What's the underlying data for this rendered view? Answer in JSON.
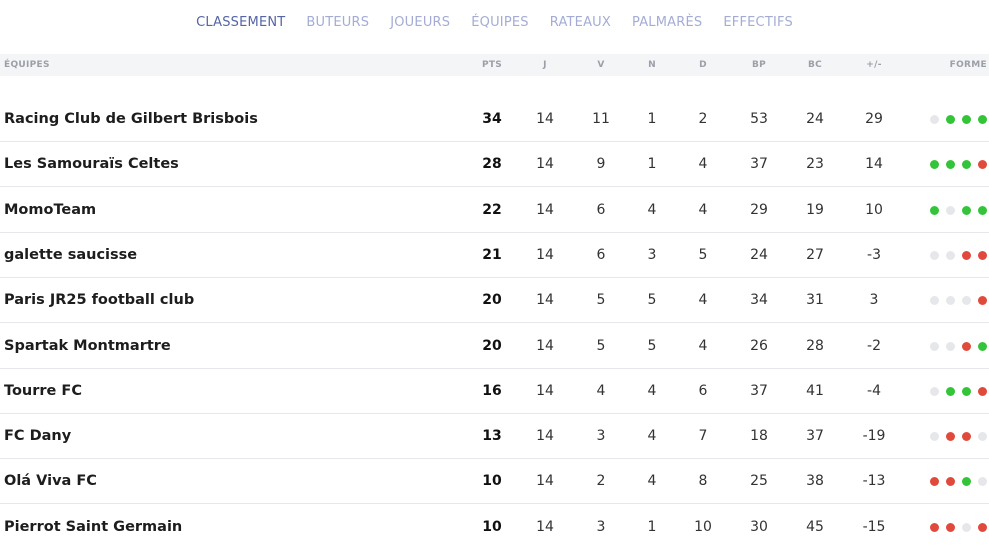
{
  "nav": [
    {
      "label": "CLASSEMENT",
      "active": true
    },
    {
      "label": "BUTEURS",
      "active": false
    },
    {
      "label": "JOUEURS",
      "active": false
    },
    {
      "label": "ÉQUIPES",
      "active": false
    },
    {
      "label": "RATEAUX",
      "active": false
    },
    {
      "label": "PALMARÈS",
      "active": false
    },
    {
      "label": "EFFECTIFS",
      "active": false
    }
  ],
  "columns": {
    "team": "ÉQUIPES",
    "pts": "PTS",
    "j": "J",
    "v": "V",
    "n": "N",
    "d": "D",
    "bp": "BP",
    "bc": "BC",
    "diff": "+/-",
    "form": "FORME"
  },
  "rows": [
    {
      "team": "Racing Club de Gilbert Brisbois",
      "pts": "34",
      "j": "14",
      "v": "11",
      "n": "1",
      "d": "2",
      "bp": "53",
      "bc": "24",
      "diff": "29",
      "form": [
        "d",
        "w",
        "w",
        "w"
      ]
    },
    {
      "team": "Les Samouraïs Celtes",
      "pts": "28",
      "j": "14",
      "v": "9",
      "n": "1",
      "d": "4",
      "bp": "37",
      "bc": "23",
      "diff": "14",
      "form": [
        "w",
        "w",
        "w",
        "l"
      ]
    },
    {
      "team": "MomoTeam",
      "pts": "22",
      "j": "14",
      "v": "6",
      "n": "4",
      "d": "4",
      "bp": "29",
      "bc": "19",
      "diff": "10",
      "form": [
        "w",
        "d",
        "w",
        "w"
      ]
    },
    {
      "team": "galette saucisse",
      "pts": "21",
      "j": "14",
      "v": "6",
      "n": "3",
      "d": "5",
      "bp": "24",
      "bc": "27",
      "diff": "-3",
      "form": [
        "d",
        "d",
        "l",
        "l"
      ]
    },
    {
      "team": "Paris JR25 football club",
      "pts": "20",
      "j": "14",
      "v": "5",
      "n": "5",
      "d": "4",
      "bp": "34",
      "bc": "31",
      "diff": "3",
      "form": [
        "d",
        "d",
        "d",
        "l"
      ]
    },
    {
      "team": "Spartak Montmartre",
      "pts": "20",
      "j": "14",
      "v": "5",
      "n": "5",
      "d": "4",
      "bp": "26",
      "bc": "28",
      "diff": "-2",
      "form": [
        "d",
        "d",
        "l",
        "w"
      ]
    },
    {
      "team": "Tourre FC",
      "pts": "16",
      "j": "14",
      "v": "4",
      "n": "4",
      "d": "6",
      "bp": "37",
      "bc": "41",
      "diff": "-4",
      "form": [
        "d",
        "w",
        "w",
        "l"
      ]
    },
    {
      "team": "FC Dany",
      "pts": "13",
      "j": "14",
      "v": "3",
      "n": "4",
      "d": "7",
      "bp": "18",
      "bc": "37",
      "diff": "-19",
      "form": [
        "d",
        "l",
        "l",
        "d"
      ]
    },
    {
      "team": "Olá Viva FC",
      "pts": "10",
      "j": "14",
      "v": "2",
      "n": "4",
      "d": "8",
      "bp": "25",
      "bc": "38",
      "diff": "-13",
      "form": [
        "l",
        "l",
        "w",
        "d"
      ]
    },
    {
      "team": "Pierrot Saint Germain",
      "pts": "10",
      "j": "14",
      "v": "3",
      "n": "1",
      "d": "10",
      "bp": "30",
      "bc": "45",
      "diff": "-15",
      "form": [
        "l",
        "l",
        "d",
        "l"
      ]
    }
  ],
  "colors": {
    "win": "#33c43a",
    "loss": "#e04a3c",
    "neutral": "#e6e7ea",
    "nav_active": "#5565a6",
    "nav_inactive": "#a4acd6"
  }
}
